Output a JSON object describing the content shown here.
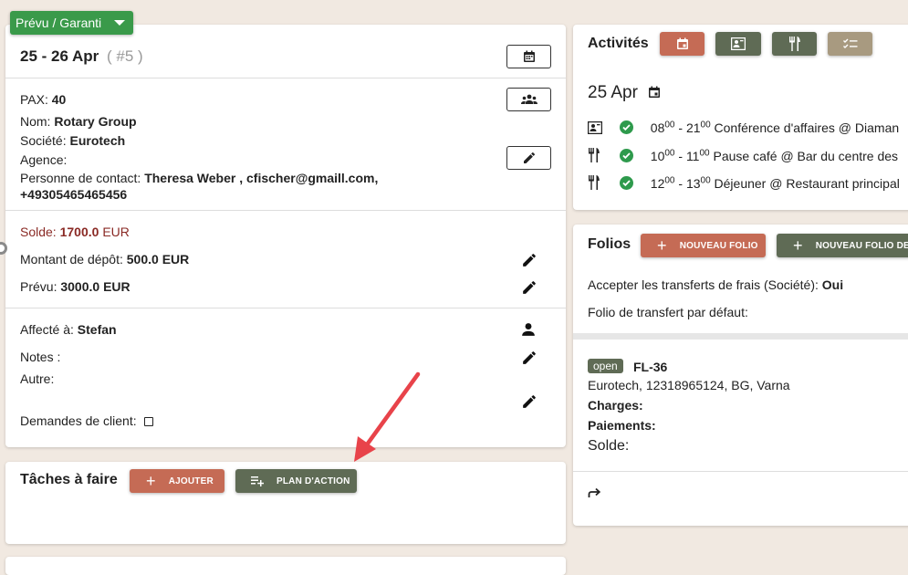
{
  "status": {
    "label": "Prévu / Garanti"
  },
  "booking": {
    "dates": "25 - 26 Apr",
    "number": "( #5 )",
    "pax_label": "PAX:",
    "pax_value": "40",
    "nom_label": "Nom:",
    "nom_value": "Rotary Group",
    "societe_label": "Société:",
    "societe_value": "Eurotech",
    "agence_label": "Agence:",
    "contact_label": "Personne de contact:",
    "contact_value_1": "Theresa Weber , cfischer@gmaill.com,",
    "contact_value_2": "+49305465465456"
  },
  "finance": {
    "solde_label": "Solde:",
    "solde_value": "1700.0",
    "solde_unit": "EUR",
    "depot_label": "Montant de dépôt:",
    "depot_value": "500.0 EUR",
    "prevu_label": "Prévu:",
    "prevu_value": "3000.0 EUR"
  },
  "details": {
    "affecte_label": "Affecté à:",
    "affecte_value": "Stefan",
    "notes_label": "Notes :",
    "autre_label": "Autre:",
    "demandes_label": "Demandes de client:"
  },
  "tasks": {
    "title": "Tâches à faire",
    "add_label": "AJOUTER",
    "plan_label": "PLAN D'ACTION"
  },
  "activities": {
    "title": "Activités",
    "date": "25 Apr",
    "buttons": [
      {
        "icon": "calendar-icon",
        "color": "#c56b55"
      },
      {
        "icon": "presentation-icon",
        "color": "#5f6b55"
      },
      {
        "icon": "restaurant-icon",
        "color": "#5f6b55"
      },
      {
        "icon": "checklist-icon",
        "color": "#a89a80"
      }
    ],
    "items": [
      {
        "icon": "presentation-icon",
        "start_h": "08",
        "start_m": "00",
        "sep": " - ",
        "end_h": "21",
        "end_m": "00",
        "text": "Conférence d'affaires @ Diaman"
      },
      {
        "icon": "restaurant-icon",
        "start_h": "10",
        "start_m": "00",
        "sep": " - ",
        "end_h": "11",
        "end_m": "00",
        "text": "Pause café @ Bar du centre des"
      },
      {
        "icon": "restaurant-icon",
        "start_h": "12",
        "start_m": "00",
        "sep": " - ",
        "end_h": "13",
        "end_m": "00",
        "text": "Déjeuner @ Restaurant principal"
      }
    ]
  },
  "folios": {
    "title": "Folios",
    "new_folio_label": "NOUVEAU FOLIO",
    "new_folio_de_label": "NOUVEAU FOLIO DE D",
    "accept_label": "Accepter les transferts de frais (Société):",
    "accept_value": "Oui",
    "default_label": "Folio de transfert par défaut:",
    "folio": {
      "status": "open",
      "id": "FL-36",
      "address": "Eurotech, 12318965124, BG, Varna",
      "charges_label": "Charges:",
      "paiements_label": "Paiements:",
      "solde_label": "Solde:"
    }
  },
  "colors": {
    "accent_brick": "#c56b55",
    "accent_olive": "#5f6b55",
    "accent_sand": "#a89a80",
    "status_green": "#3a9a4a",
    "solde_red": "#8a2a25",
    "arrow_red": "#e8434a"
  }
}
